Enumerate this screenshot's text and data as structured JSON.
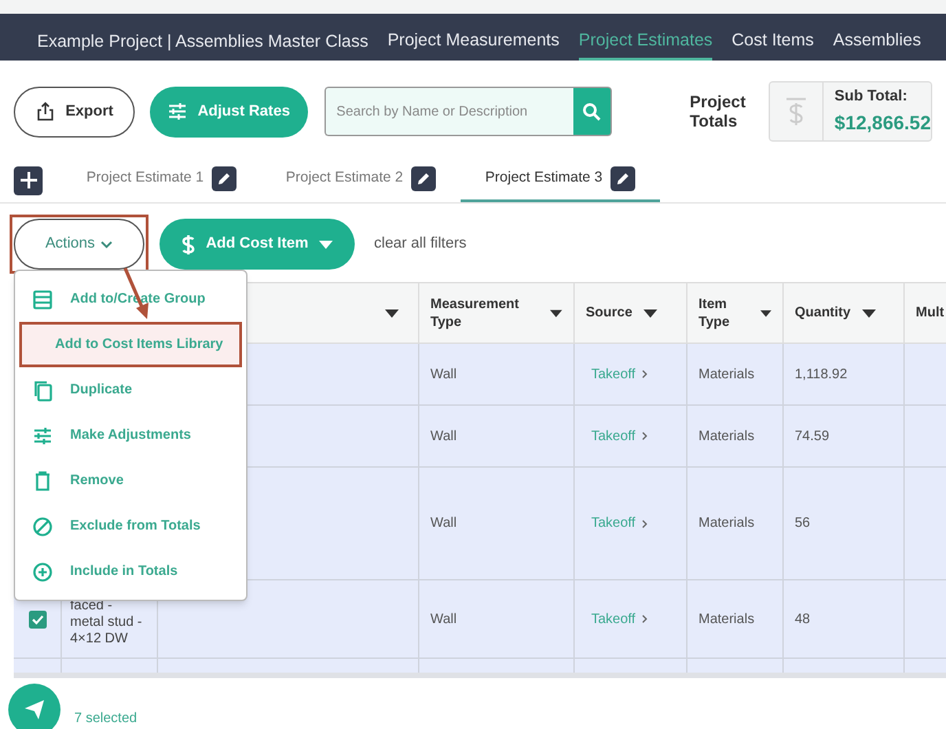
{
  "nav": {
    "project": "Example Project | Assemblies Master Class",
    "tabs": [
      {
        "label": "Project Measurements",
        "selected": false
      },
      {
        "label": "Project Estimates",
        "selected": true
      },
      {
        "label": "Cost Items",
        "selected": false
      },
      {
        "label": "Assemblies",
        "selected": false
      }
    ]
  },
  "toolbar": {
    "export": "Export",
    "adjust_rates": "Adjust Rates",
    "search": {
      "placeholder": "Search by Name or Description"
    },
    "totals_label": "Project Totals",
    "subtotal_label": "Sub Total:",
    "subtotal_value": "$12,866.52"
  },
  "estimate_tabs": [
    {
      "label": "Project Estimate 1",
      "selected": false
    },
    {
      "label": "Project Estimate 2",
      "selected": false
    },
    {
      "label": "Project Estimate 3",
      "selected": true
    }
  ],
  "actions": {
    "label": "Actions",
    "highlighted": true,
    "add_cost_item": "Add Cost Item",
    "clear_filters": "clear all filters"
  },
  "menu": [
    {
      "label": "Add to/Create Group",
      "kind": "group",
      "highlighted": false
    },
    {
      "label": "Add to Cost Items Library",
      "kind": "library",
      "highlighted": true
    },
    {
      "label": "Duplicate",
      "kind": "duplicate",
      "highlighted": false
    },
    {
      "label": "Make Adjustments",
      "kind": "adjust",
      "highlighted": false
    },
    {
      "label": "Remove",
      "kind": "remove",
      "highlighted": false
    },
    {
      "label": "Exclude from Totals",
      "kind": "exclude",
      "highlighted": false
    },
    {
      "label": "Include in Totals",
      "kind": "include",
      "highlighted": false
    }
  ],
  "table": {
    "columns": [
      "Measurement Type",
      "Source",
      "Item Type",
      "Quantity",
      "Mult"
    ],
    "rows": [
      {
        "measurement_type": "Wall",
        "source": "Takeoff",
        "item_type": "Materials",
        "quantity": "1,118.92"
      },
      {
        "measurement_type": "Wall",
        "source": "Takeoff",
        "item_type": "Materials",
        "quantity": "74.59"
      },
      {
        "measurement_type": "Wall",
        "source": "Takeoff",
        "item_type": "Materials",
        "quantity": "56"
      },
      {
        "name": "faced - metal stud - 4×12 DW",
        "checked": true,
        "measurement_type": "Wall",
        "source": "Takeoff",
        "item_type": "Materials",
        "quantity": "48"
      }
    ]
  },
  "footer": {
    "selected_count": "7 selected"
  }
}
